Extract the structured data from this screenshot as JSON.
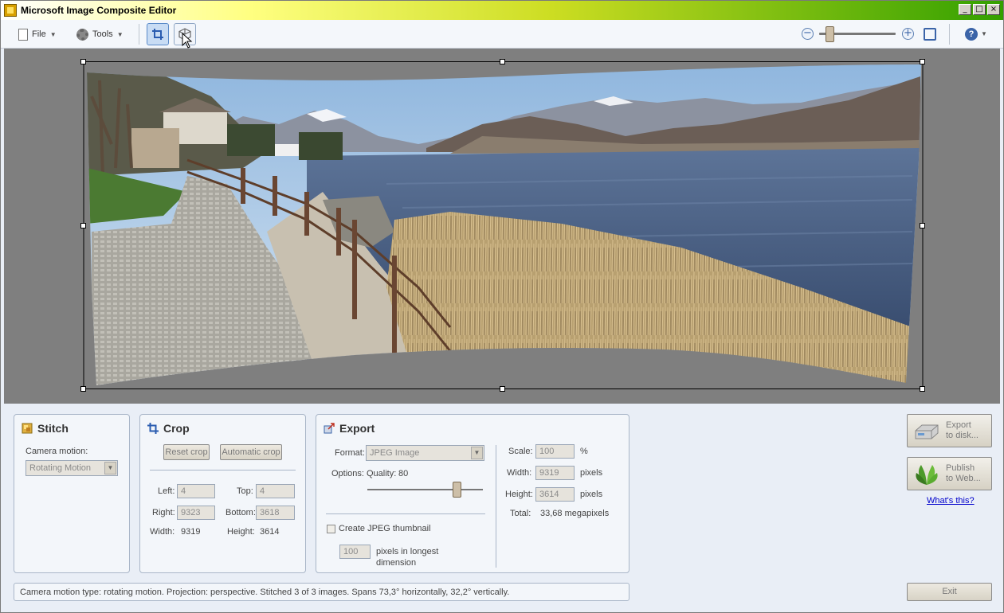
{
  "window": {
    "title": "Microsoft Image Composite Editor",
    "controls": {
      "minimize": "_",
      "maximize": "□",
      "close": "×"
    }
  },
  "toolbar": {
    "file_label": "File",
    "tools_label": "Tools",
    "help_label": "?",
    "zoom_out": "−",
    "zoom_in": "+",
    "zoom_level": 0.1
  },
  "stitch": {
    "title": "Stitch",
    "camera_motion_label": "Camera motion:",
    "camera_motion_value": "Rotating Motion"
  },
  "crop": {
    "title": "Crop",
    "reset_label": "Reset crop",
    "auto_label": "Automatic crop",
    "left_label": "Left:",
    "left_value": "4",
    "top_label": "Top:",
    "top_value": "4",
    "right_label": "Right:",
    "right_value": "9323",
    "bottom_label": "Bottom:",
    "bottom_value": "3618",
    "width_label": "Width:",
    "width_value": "9319",
    "height_label": "Height:",
    "height_value": "3614"
  },
  "export": {
    "title": "Export",
    "format_label": "Format:",
    "format_value": "JPEG Image",
    "options_label": "Options:",
    "quality_label": "Quality:",
    "quality_value": "80",
    "quality_level": 0.8,
    "thumbnail_label": "Create JPEG thumbnail",
    "thumbnail_size": "100",
    "thumbnail_unit_line1": "pixels in longest",
    "thumbnail_unit_line2": "dimension",
    "scale_label": "Scale:",
    "scale_value": "100",
    "scale_unit": "%",
    "width_label": "Width:",
    "width_value": "9319",
    "width_unit": "pixels",
    "height_label": "Height:",
    "height_value": "3614",
    "height_unit": "pixels",
    "total_label": "Total:",
    "total_value": "33,68 megapixels"
  },
  "actions": {
    "export_disk_line1": "Export",
    "export_disk_line2": "to disk...",
    "publish_line1": "Publish",
    "publish_line2": "to Web...",
    "whats_this": "What's this?",
    "exit_label": "Exit"
  },
  "status": {
    "text": "Camera motion type: rotating motion. Projection: perspective. Stitched 3 of 3 images. Spans 73,3° horizontally, 32,2° vertically."
  },
  "colors": {
    "canvas_bg": "#7f7f7f",
    "panel_bg": "#f3f6fa",
    "accent": "#3b64a8",
    "water": "#3d5478"
  }
}
